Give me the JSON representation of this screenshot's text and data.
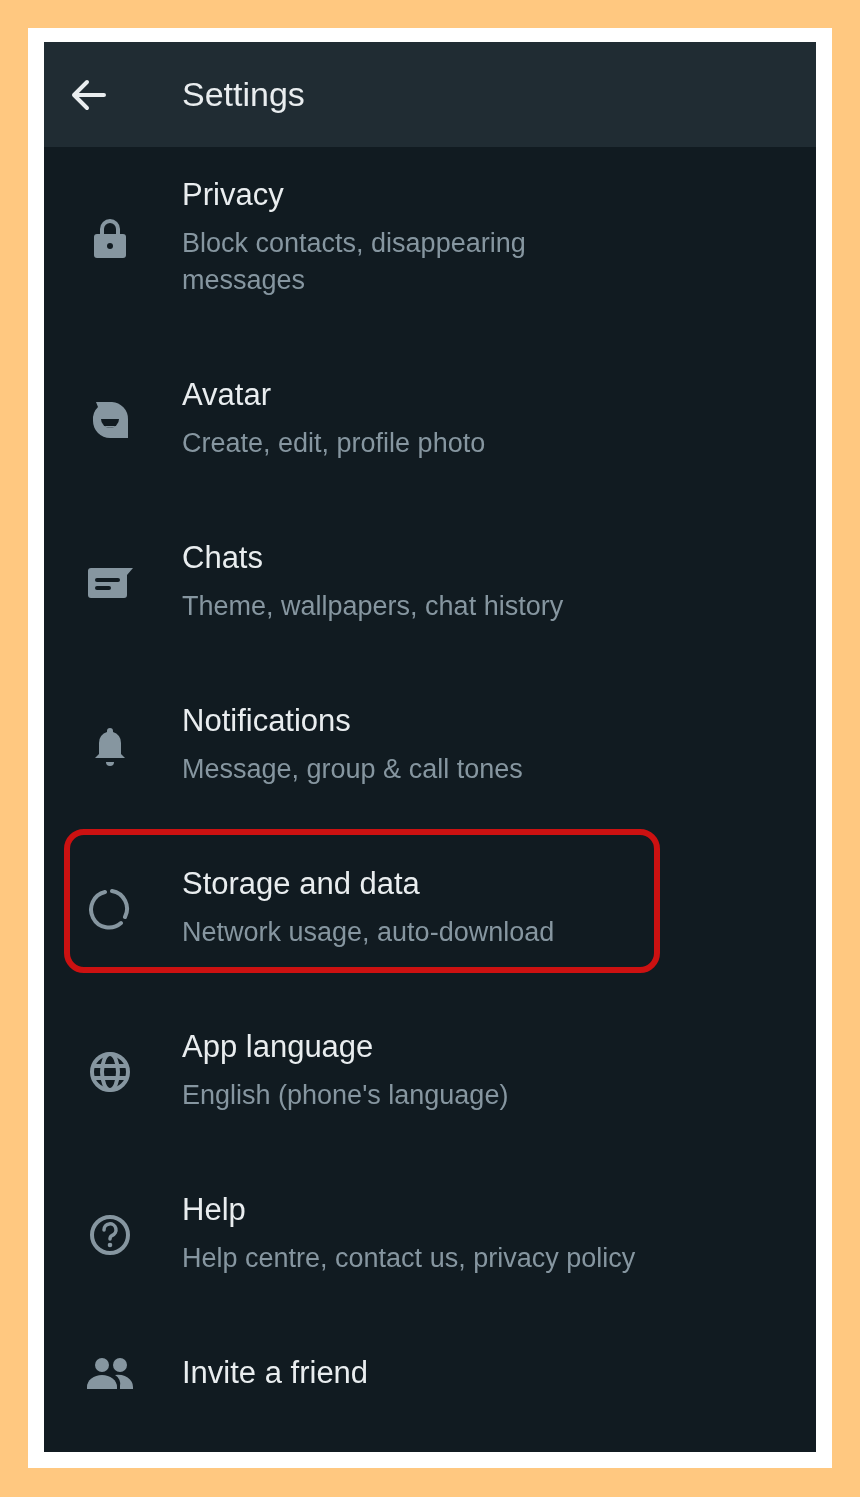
{
  "header": {
    "title": "Settings"
  },
  "items": [
    {
      "title": "Privacy",
      "subtitle": "Block contacts, disappearing messages",
      "highlighted": false
    },
    {
      "title": "Avatar",
      "subtitle": "Create, edit, profile photo",
      "highlighted": false
    },
    {
      "title": "Chats",
      "subtitle": "Theme, wallpapers, chat history",
      "highlighted": false
    },
    {
      "title": "Notifications",
      "subtitle": "Message, group & call tones",
      "highlighted": false
    },
    {
      "title": "Storage and data",
      "subtitle": "Network usage, auto-download",
      "highlighted": true
    },
    {
      "title": "App language",
      "subtitle": "English (phone's language)",
      "highlighted": false
    },
    {
      "title": "Help",
      "subtitle": "Help centre, contact us, privacy policy",
      "highlighted": false
    },
    {
      "title": "Invite a friend",
      "highlighted": false
    }
  ]
}
